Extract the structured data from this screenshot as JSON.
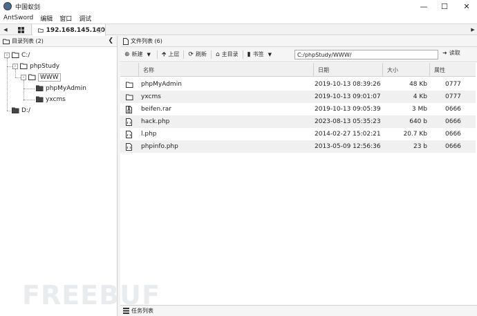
{
  "window": {
    "title": "中国蚁剑"
  },
  "menu": [
    "AntSword",
    "编辑",
    "窗口",
    "调试"
  ],
  "tabs": {
    "session_label": "192.168.145.140"
  },
  "dir_panel": {
    "title": "目录列表 (2)",
    "tree": [
      {
        "label": "C:/"
      },
      {
        "label": "phpStudy"
      },
      {
        "label": "WWW"
      },
      {
        "label": "phpMyAdmin"
      },
      {
        "label": "yxcms"
      },
      {
        "label": "D:/"
      }
    ]
  },
  "file_panel": {
    "title": "文件列表 (6)",
    "toolbar": {
      "new": "新建",
      "up": "上层",
      "refresh": "刷新",
      "home": "主目录",
      "bookmark": "书签",
      "read": "读取"
    },
    "path": "C:/phpStudy/WWW/",
    "columns": {
      "name": "名称",
      "date": "日期",
      "size": "大小",
      "attr": "属性"
    },
    "rows": [
      {
        "name": "phpMyAdmin",
        "date": "2019-10-13 08:39:26",
        "size": "48 Kb",
        "attr": "0777",
        "icon": "folder"
      },
      {
        "name": "yxcms",
        "date": "2019-10-13 09:01:07",
        "size": "4 Kb",
        "attr": "0777",
        "icon": "folder"
      },
      {
        "name": "beifen.rar",
        "date": "2019-10-13 09:05:39",
        "size": "3 Mb",
        "attr": "0666",
        "icon": "archive"
      },
      {
        "name": "hack.php",
        "date": "2023-08-13 05:35:23",
        "size": "640 b",
        "attr": "0666",
        "icon": "php"
      },
      {
        "name": "l.php",
        "date": "2014-02-27 15:02:21",
        "size": "20.7 Kb",
        "attr": "0666",
        "icon": "php"
      },
      {
        "name": "phpinfo.php",
        "date": "2013-05-09 12:56:36",
        "size": "23 b",
        "attr": "0666",
        "icon": "php"
      }
    ]
  },
  "task_panel": {
    "title": "任务列表"
  },
  "watermark": "FREEBUF"
}
